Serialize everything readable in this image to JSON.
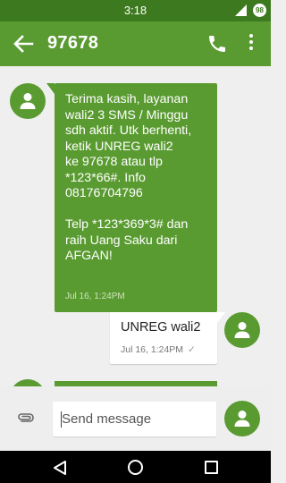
{
  "status_bar": {
    "time": "3:18",
    "battery_level": "98"
  },
  "app_bar": {
    "title": "97678"
  },
  "messages": [
    {
      "direction": "incoming",
      "text": "Terima kasih, layanan\nwali2 3 SMS / Minggu\nsdh aktif. Utk berhenti,\nketik UNREG wali2\nke 97678 atau tlp\n*123*66#. Info\n08176704796\n\nTelp *123*369*3# dan\nraih Uang Saku dari\nAFGAN!",
      "timestamp": "Jul 16, 1:24PM"
    },
    {
      "direction": "outgoing",
      "text": "UNREG wali2",
      "timestamp": "Jul 16, 1:24PM",
      "status_icon": "check-icon"
    }
  ],
  "compose": {
    "placeholder": "Send message"
  },
  "colors": {
    "status_bar": "#3d7a1f",
    "app_bar": "#5a9b31",
    "incoming_bubble": "#5a9b31",
    "outgoing_bubble": "#ffffff",
    "background": "#efefef"
  }
}
